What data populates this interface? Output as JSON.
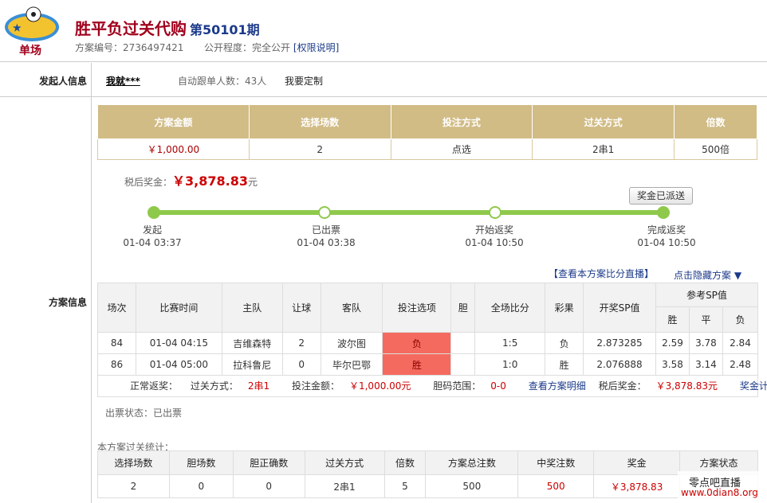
{
  "header": {
    "logo_text": "单场",
    "title": "胜平负过关代购",
    "issue": "第50101期",
    "plan_no_label": "方案编号：",
    "plan_no": "2736497421",
    "visibility_label": "公开程度：",
    "visibility": "完全公开",
    "permission_link": "[权限说明]"
  },
  "initiator": {
    "section_label": "发起人信息",
    "name": "我就***",
    "auto_follow_label": "自动跟单人数：",
    "auto_follow_count": "43人",
    "custom_link": "我要定制"
  },
  "plan": {
    "section_label": "方案信息",
    "summary_headers": [
      "方案金额",
      "选择场数",
      "投注方式",
      "过关方式",
      "倍数"
    ],
    "summary_values": [
      "￥1,000.00",
      "2",
      "点选",
      "2串1",
      "500倍"
    ],
    "after_tax_label": "税后奖金：",
    "after_tax_amount": "￥3,878.83",
    "after_tax_unit": "元",
    "paid_button": "奖金已派送",
    "steps": [
      {
        "label": "发起",
        "time": "01-04 03:37"
      },
      {
        "label": "已出票",
        "time": "01-04 03:38"
      },
      {
        "label": "开始返奖",
        "time": "01-04 10:50"
      },
      {
        "label": "完成返奖",
        "time": "01-04 10:50"
      }
    ],
    "live_link": "【查看本方案比分直播】",
    "hide_link": "点击隐藏方案 ▼"
  },
  "matches": {
    "headers": [
      "场次",
      "比赛时间",
      "主队",
      "让球",
      "客队",
      "投注选项",
      "胆",
      "全场比分",
      "彩果",
      "开奖SP值",
      "参考SP值"
    ],
    "sp_sub": [
      "胜",
      "平",
      "负"
    ],
    "rows": [
      {
        "no": "84",
        "time": "01-04 04:15",
        "home": "吉维森特",
        "handicap": "2",
        "away": "波尔图",
        "pick": "负",
        "banker": "",
        "score": "1:5",
        "result": "负",
        "sp": "2.873285",
        "ref": [
          "2.59",
          "3.78",
          "2.84"
        ]
      },
      {
        "no": "86",
        "time": "01-04 05:00",
        "home": "拉科鲁尼",
        "handicap": "0",
        "away": "毕尔巴鄂",
        "pick": "胜",
        "banker": "",
        "score": "1:0",
        "result": "胜",
        "sp": "2.076888",
        "ref": [
          "3.58",
          "3.14",
          "2.48"
        ]
      }
    ],
    "footer": {
      "normal_prize": "正常返奖：",
      "pass_label": "过关方式：",
      "pass_value": "2串1",
      "bet_label": "投注金额：",
      "bet_value": "￥1,000.00元",
      "banker_label": "胆码范围：",
      "banker_value": "0-0",
      "detail_link": "查看方案明细",
      "tax_label": "税后奖金：",
      "tax_value": "￥3,878.83元",
      "calc_link": "奖金计算器"
    },
    "ticket_status": "出票状态：已出票"
  },
  "stats": {
    "title": "本方案过关统计：",
    "headers": [
      "选择场数",
      "胆场数",
      "胆正确数",
      "过关方式",
      "倍数",
      "方案总注数",
      "中奖注数",
      "奖金",
      "方案状态"
    ],
    "values": [
      "2",
      "0",
      "0",
      "2串1",
      "5",
      "500",
      "500",
      "￥3,878.83",
      ""
    ]
  },
  "watermark": {
    "line1": "零点吧直播",
    "line2": "www.0dian8.org"
  }
}
